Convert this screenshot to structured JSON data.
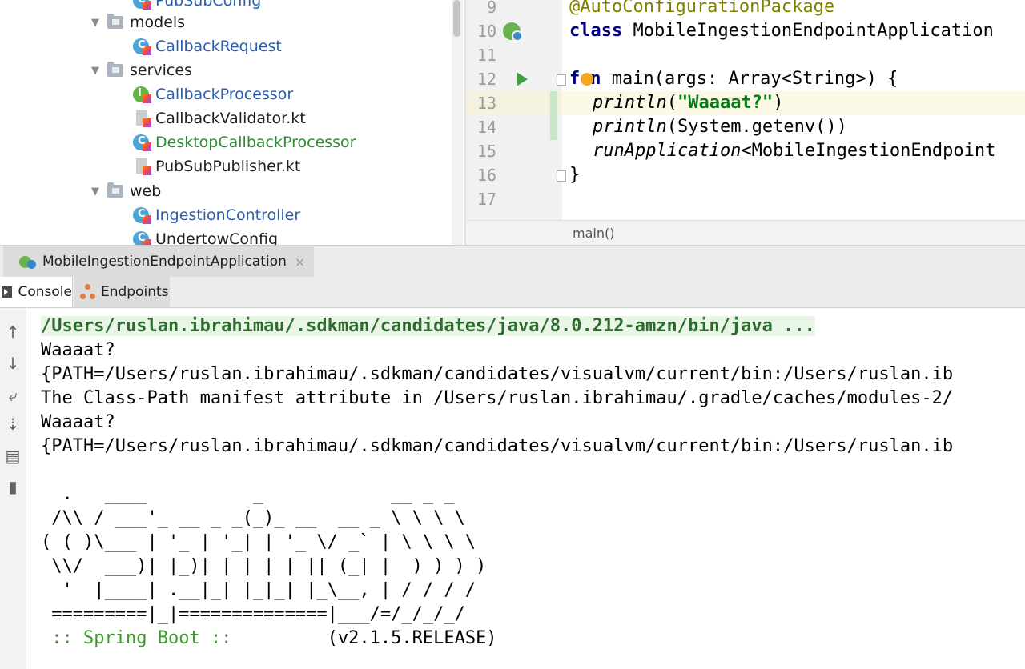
{
  "project_tree": {
    "items": [
      {
        "label": "PubSubConfig",
        "type": "kotlin-class",
        "color": "blue"
      },
      {
        "label": "models",
        "type": "folder"
      },
      {
        "label": "CallbackRequest",
        "type": "kotlin-class",
        "color": "blue"
      },
      {
        "label": "services",
        "type": "folder"
      },
      {
        "label": "CallbackProcessor",
        "type": "kotlin-interface",
        "color": "blue"
      },
      {
        "label": "CallbackValidator.kt",
        "type": "kotlin-file",
        "color": "plain"
      },
      {
        "label": "DesktopCallbackProcessor",
        "type": "kotlin-class",
        "color": "green"
      },
      {
        "label": "PubSubPublisher.kt",
        "type": "kotlin-file",
        "color": "plain"
      },
      {
        "label": "web",
        "type": "folder"
      },
      {
        "label": "IngestionController",
        "type": "kotlin-class",
        "color": "blue"
      },
      {
        "label": "UndertowConfig",
        "type": "kotlin-class",
        "color": "plain"
      }
    ]
  },
  "editor": {
    "line_numbers": [
      "9",
      "10",
      "11",
      "12",
      "13",
      "14",
      "15",
      "16",
      "17"
    ],
    "lines": {
      "l9_annotation": "@AutoConfigurationPackage",
      "l10_keyword": "class",
      "l10_rest": " MobileIngestionEndpointApplication",
      "l12_kw_f": "f",
      "l12_kw_n": "n",
      "l12_rest": " main(args: Array<String>) {",
      "l13_fn": "println",
      "l13_open": "(",
      "l13_str": "\"Waaaat?\"",
      "l13_close": ")",
      "l14_fn": "println",
      "l14_rest": "(System.getenv())",
      "l15_fn": "runApplication",
      "l15_rest": "<MobileIngestionEndpoint",
      "l16_brace": "}"
    },
    "breadcrumb": "main()"
  },
  "run_window": {
    "tab_label": "MobileIngestionEndpointApplication",
    "tab_close": "×",
    "subtabs": {
      "console": "Console",
      "endpoints": "Endpoints"
    }
  },
  "console": {
    "command": "/Users/ruslan.ibrahimau/.sdkman/candidates/java/8.0.212-amzn/bin/java ...",
    "line2": "Waaaat?",
    "line3": "{PATH=/Users/ruslan.ibrahimau/.sdkman/candidates/visualvm/current/bin:/Users/ruslan.ib",
    "line4": "The Class-Path manifest attribute in /Users/ruslan.ibrahimau/.gradle/caches/modules-2/",
    "line5": "Waaaat?",
    "line6": "{PATH=/Users/ruslan.ibrahimau/.sdkman/candidates/visualvm/current/bin:/Users/ruslan.ib",
    "banner1": "  .   ____          _            __ _ _",
    "banner2": " /\\\\ / ___'_ __ _ _(_)_ __  __ _ \\ \\ \\ \\",
    "banner3": "( ( )\\___ | '_ | '_| | '_ \\/ _` | \\ \\ \\ \\",
    "banner4": " \\\\/  ___)| |_)| | | | | || (_| |  ) ) ) )",
    "banner5": "  '  |____| .__|_| |_|_| |_\\__, | / / / /",
    "banner6": " =========|_|==============|___/=/_/_/_/",
    "spring_prefix": " :: ",
    "spring_label": "Spring Boot",
    "spring_sep": " :: ",
    "spring_version": "        (v2.1.5.RELEASE)"
  },
  "colors": {
    "keyword": "#000080",
    "annotation": "#808000",
    "string": "#067d17",
    "tree_blue": "#2a5db0",
    "tree_green": "#2e8c32",
    "spring_green": "#3c9a2c"
  }
}
